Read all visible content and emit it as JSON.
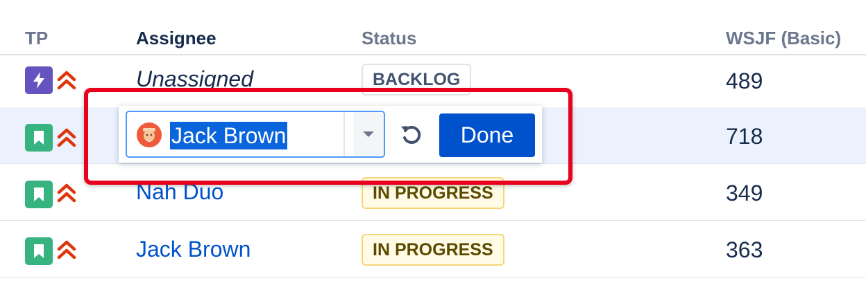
{
  "table": {
    "headers": {
      "tp": "TP",
      "assignee": "Assignee",
      "status": "Status",
      "wsjf": "WSJF (Basic)"
    },
    "rows": [
      {
        "type_icon": "epic-lightning-icon",
        "priority_icon": "highest-priority-icon",
        "assignee": "Unassigned",
        "status": "BACKLOG",
        "wsjf": "489"
      },
      {
        "type_icon": "story-bookmark-icon",
        "priority_icon": "highest-priority-icon",
        "assignee": "",
        "status": "",
        "wsjf": "718"
      },
      {
        "type_icon": "story-bookmark-icon",
        "priority_icon": "highest-priority-icon",
        "assignee": "Nah Duo",
        "status": "IN PROGRESS",
        "wsjf": "349"
      },
      {
        "type_icon": "story-bookmark-icon",
        "priority_icon": "highest-priority-icon",
        "assignee": "Jack Brown",
        "status": "IN PROGRESS",
        "wsjf": "363"
      }
    ]
  },
  "inline_editor": {
    "selected_value": "Jack Brown",
    "avatar_icon": "user-avatar-icon",
    "dropdown_icon": "chevron-down-icon",
    "undo_icon": "undo-icon",
    "done_label": "Done"
  },
  "colors": {
    "link": "#0052cc",
    "highlight_border": "#e8001e",
    "epic": "#6554c0",
    "story": "#36b37e",
    "priority": "#de350b",
    "selected_row": "#ebf2fd"
  }
}
